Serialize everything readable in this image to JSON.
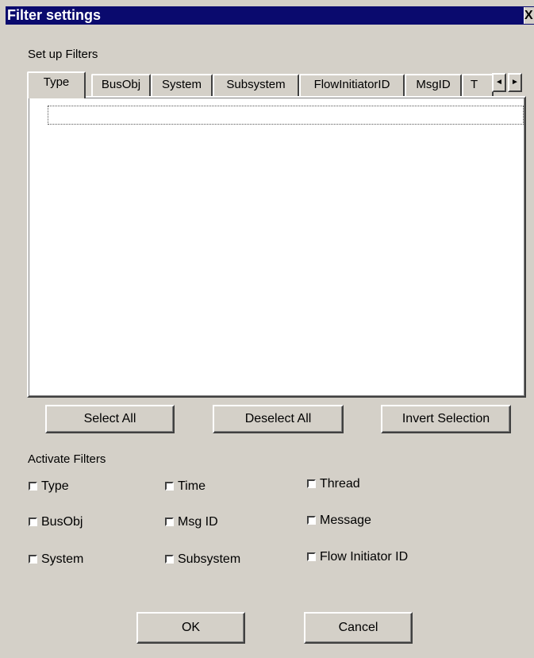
{
  "window": {
    "title": "Filter settings",
    "close_glyph": "X"
  },
  "setup_label": "Set up Filters",
  "tabs": [
    "Type",
    "BusObj",
    "System",
    "Subsystem",
    "FlowInitiatorID",
    "MsgID",
    "T"
  ],
  "tab_scroll": {
    "left": "◄",
    "right": "►"
  },
  "selection_buttons": {
    "select_all": "Select All",
    "deselect_all": "Deselect All",
    "invert_selection": "Invert Selection"
  },
  "activate_label": "Activate Filters",
  "filters": [
    {
      "label": "Type",
      "checked": false
    },
    {
      "label": "Time",
      "checked": false
    },
    {
      "label": "Thread",
      "checked": false
    },
    {
      "label": "BusObj",
      "checked": false
    },
    {
      "label": "Msg ID",
      "checked": false
    },
    {
      "label": "Message",
      "checked": false
    },
    {
      "label": "System",
      "checked": false
    },
    {
      "label": "Subsystem",
      "checked": false
    },
    {
      "label": "Flow Initiator ID",
      "checked": false
    }
  ],
  "dialog_buttons": {
    "ok": "OK",
    "cancel": "Cancel"
  }
}
